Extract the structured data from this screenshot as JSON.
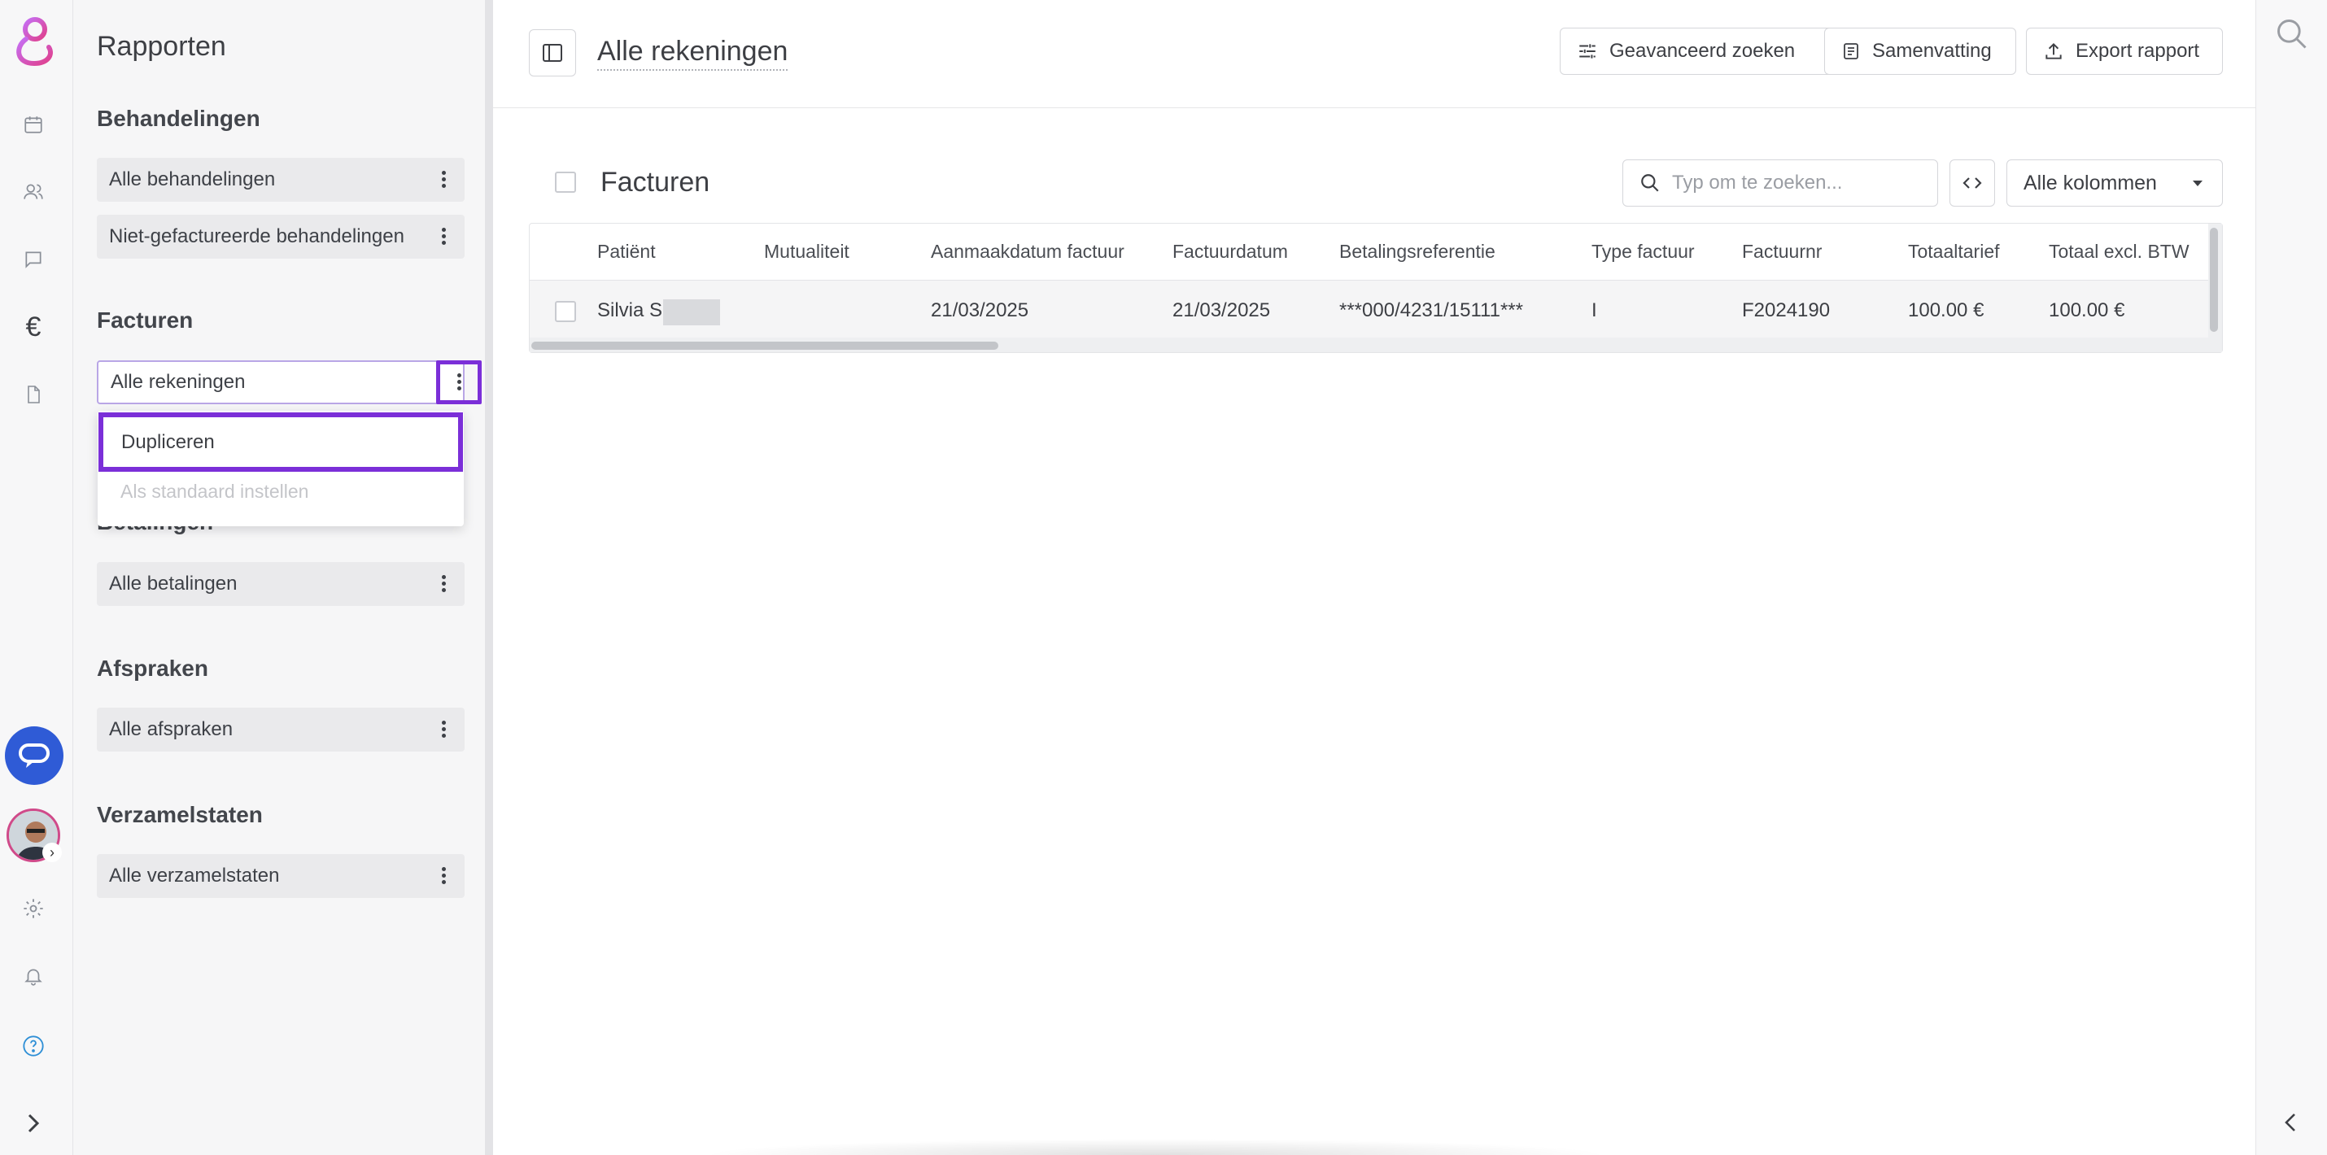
{
  "colors": {
    "brand": "#8a3ffc",
    "highlight": "#7b2fd8",
    "chat": "#2f5bd6"
  },
  "rail": {
    "icons": [
      "logo-icon",
      "calendar-icon",
      "users-icon",
      "chat-icon",
      "euro-icon",
      "document-icon",
      "support-chat-icon",
      "avatar",
      "settings-icon",
      "bell-icon",
      "help-icon",
      "expand-icon"
    ],
    "euro_symbol": "€"
  },
  "sidebar": {
    "title": "Rapporten",
    "sections": [
      {
        "title": "Behandelingen",
        "items": [
          "Alle behandelingen",
          "Niet-gefactureerde behandelingen"
        ]
      },
      {
        "title": "Facturen",
        "items": [
          "Alle rekeningen"
        ]
      },
      {
        "title": "Betalingen",
        "items": [
          "Alle betalingen"
        ]
      },
      {
        "title": "Afspraken",
        "items": [
          "Alle afspraken"
        ]
      },
      {
        "title": "Verzamelstaten",
        "items": [
          "Alle verzamelstaten"
        ]
      }
    ],
    "menu": {
      "duplicate": "Dupliceren",
      "set_default": "Als standaard instellen"
    }
  },
  "header": {
    "title": "Alle rekeningen",
    "buttons": {
      "advanced_search": "Geavanceerd zoeken",
      "summary": "Samenvatting",
      "export": "Export rapport"
    }
  },
  "table_panel": {
    "title": "Facturen",
    "search_placeholder": "Typ om te zoeken...",
    "columns_select": "Alle kolommen",
    "columns": [
      "Patiënt",
      "Mutualiteit",
      "Aanmaakdatum factuur",
      "Factuurdatum",
      "Betalingsreferentie",
      "Type factuur",
      "Factuurnr",
      "Totaaltarief",
      "Totaal excl. BTW"
    ],
    "rows": [
      {
        "patient": "Silvia S",
        "mutualiteit": "",
        "aanmaakdatum": "21/03/2025",
        "factuurdatum": "21/03/2025",
        "referentie": "***000/4231/15111***",
        "type": "I",
        "factuurnr": "F2024190",
        "totaaltarief": "100.00 €",
        "totaal_excl": "100.00 €"
      }
    ]
  }
}
